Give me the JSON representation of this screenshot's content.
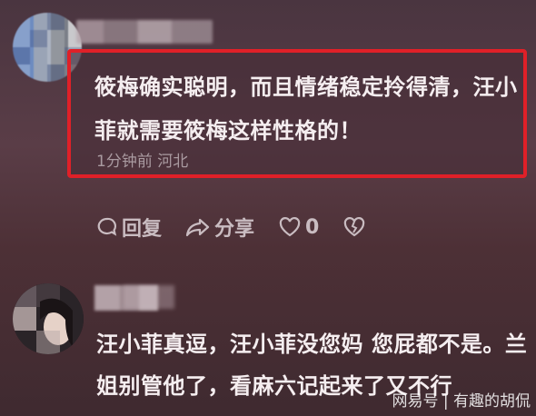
{
  "comment1": {
    "text_line1": "筱梅确实聪明，而且情绪稳定拎得清，汪小",
    "text_line2": "菲就需要筱梅这样性格的！",
    "meta": "1分钟前 河北"
  },
  "actions": {
    "reply_label": "回复",
    "share_label": "分享",
    "like_count": "0"
  },
  "comment2": {
    "text_line1": "汪小菲真逗，汪小菲没您妈 您屁都不是。兰",
    "text_line2": "姐别管他了，看麻六记起来了又不行"
  },
  "watermark": "网易号 | 有趣的胡侃",
  "colors": {
    "highlight": "#e02028",
    "background": "#4a3540"
  }
}
